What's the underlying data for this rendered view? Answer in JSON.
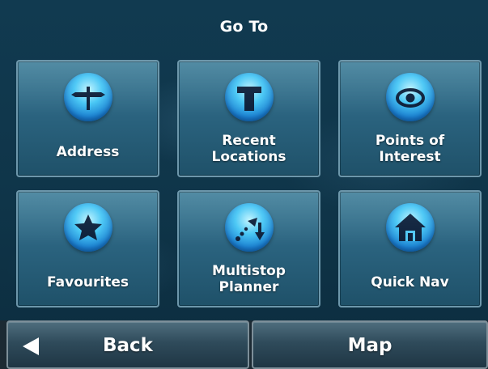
{
  "header": {
    "title": "Go To"
  },
  "tiles": [
    {
      "label": "Address",
      "icon": "signpost-icon"
    },
    {
      "label": "Recent\nLocations",
      "icon": "recent-locations-icon"
    },
    {
      "label": "Points of\nInterest",
      "icon": "eye-icon"
    },
    {
      "label": "Favourites",
      "icon": "star-icon"
    },
    {
      "label": "Multistop\nPlanner",
      "icon": "route-arrows-icon"
    },
    {
      "label": "Quick Nav",
      "icon": "home-icon"
    }
  ],
  "footer": {
    "back_label": "Back",
    "back_icon": "left-arrow-icon",
    "map_label": "Map"
  },
  "colors": {
    "background": "#0f3549",
    "tile": "#2b6480",
    "tile_border": "#6d97ab",
    "icon_orb": "#1a7fd0",
    "icon_glyph": "#0b1f3a",
    "text": "#ffffff"
  }
}
